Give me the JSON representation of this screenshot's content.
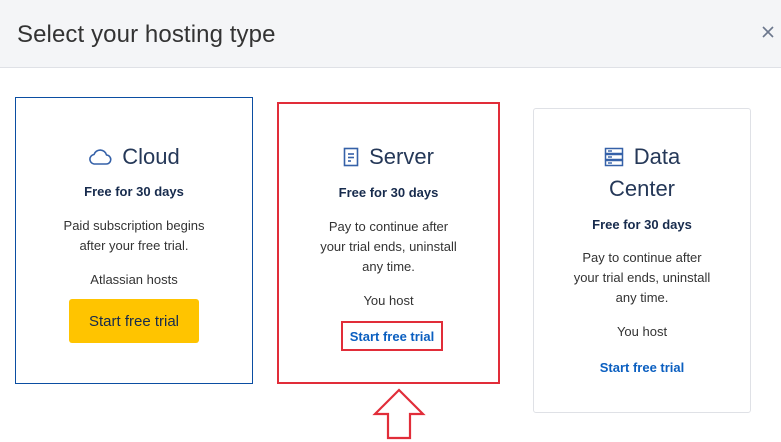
{
  "modal": {
    "title": "Select your hosting type",
    "close_icon": "close-icon"
  },
  "cards": [
    {
      "title": "Cloud",
      "icon": "cloud-icon",
      "price": "Free for 30 days",
      "description_lines": [
        "Paid subscription begins",
        "after your free trial."
      ],
      "host": "Atlassian hosts",
      "cta": "Start free trial"
    },
    {
      "title": "Server",
      "icon": "server-icon",
      "price": "Free for 30 days",
      "description_lines": [
        "Pay to continue after",
        "your trial ends, uninstall",
        "any time."
      ],
      "host": "You host",
      "cta": "Start free trial"
    },
    {
      "title_lines": [
        "Data",
        "Center"
      ],
      "icon": "data-center-icon",
      "price": "Free for 30 days",
      "description_lines": [
        "Pay to continue after",
        "your trial ends, uninstall",
        "any time."
      ],
      "host": "You host",
      "cta": "Start free trial"
    }
  ],
  "annotation": {
    "arrow_icon": "up-arrow-icon"
  },
  "colors": {
    "header_bg": "#f4f5f7",
    "primary_button": "#ffc400",
    "link": "#0b5fc0",
    "highlight": "#e12d39",
    "selected_border": "#0b4ea2",
    "icon": "#3561a8"
  }
}
